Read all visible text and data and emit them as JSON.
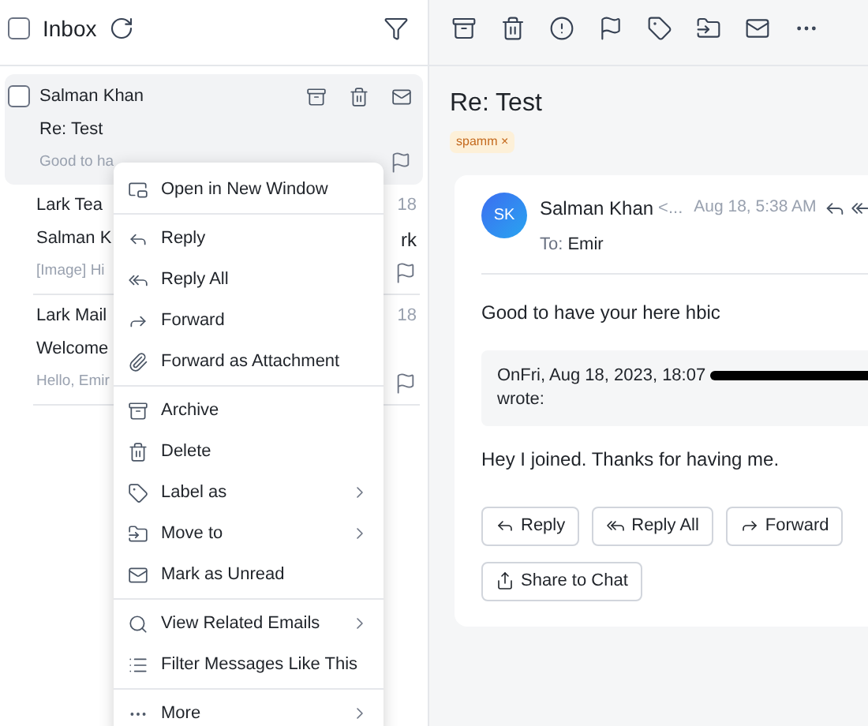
{
  "list_header": {
    "title": "Inbox",
    "checked": false
  },
  "mails": [
    {
      "selected": true,
      "checked": false,
      "name": "Salman Khan",
      "subject": "Re: Test",
      "preview": "Good to ha"
    },
    {
      "selected": false,
      "name": "Lark Tea",
      "subject": "Salman K",
      "preview": "[Image] Hi",
      "date": "18",
      "subject_end": "rk"
    },
    {
      "selected": false,
      "name": "Lark Mail",
      "subject": "Welcome",
      "preview": "Hello, Emir",
      "date": "18"
    }
  ],
  "context_menu": {
    "groups": [
      [
        {
          "label": "Open in New Window",
          "submenu": false
        }
      ],
      [
        {
          "label": "Reply",
          "submenu": false
        },
        {
          "label": "Reply All",
          "submenu": false
        },
        {
          "label": "Forward",
          "submenu": false
        },
        {
          "label": "Forward as Attachment",
          "submenu": false
        }
      ],
      [
        {
          "label": "Archive",
          "submenu": false
        },
        {
          "label": "Delete",
          "submenu": false
        },
        {
          "label": "Label as",
          "submenu": true
        },
        {
          "label": "Move to",
          "submenu": true
        },
        {
          "label": "Mark as Unread",
          "submenu": false
        }
      ],
      [
        {
          "label": "View Related Emails",
          "submenu": true
        },
        {
          "label": "Filter Messages Like This",
          "submenu": false
        }
      ],
      [
        {
          "label": "More",
          "submenu": true
        }
      ]
    ]
  },
  "message": {
    "subject": "Re: Test",
    "tag": "spamm",
    "tag_close": "×",
    "avatar": "SK",
    "sender": "Salman Khan",
    "sender_address": "<...",
    "time": "Aug 18, 5:38 AM",
    "to_label": "To:",
    "to": "Emir",
    "body": "Good to have your here hbic",
    "quote_header": "OnFri, Aug 18, 2023, 18:07",
    "quote_wrote": "wrote:",
    "reply_text": "Hey I joined. Thanks for having me.",
    "buttons": [
      "Reply",
      "Reply All",
      "Forward",
      "Share to Chat"
    ]
  }
}
